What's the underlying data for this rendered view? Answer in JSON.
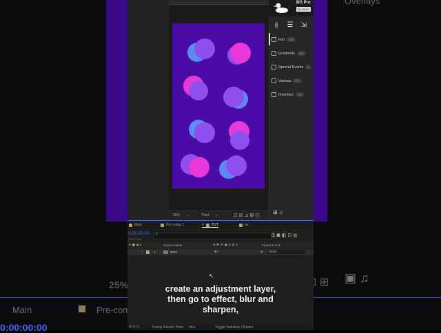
{
  "background": {
    "top_right_label": "Overlays",
    "zoom": "25%",
    "tab_main": "Main",
    "tab_precomp": "Pre-comp",
    "timecode": "0:00:00:00"
  },
  "viewer": {
    "zoom": "25%",
    "resolution": "Third"
  },
  "plugin": {
    "title": "BG Pro",
    "subtitle": "by Sono",
    "categories": [
      {
        "label": "Flat",
        "count": "155"
      },
      {
        "label": "Gradients",
        "count": "185"
      },
      {
        "label": "Special Events",
        "count": "4"
      },
      {
        "label": "Various",
        "count": "277"
      },
      {
        "label": "Overlays",
        "count": "233"
      }
    ]
  },
  "timeline": {
    "tabs": [
      "Main",
      "Pre-comp 1",
      "TUT",
      "ee"
    ],
    "timecode": "0;00;00;00",
    "fps": "(29.97 fps)",
    "search_placeholder": "",
    "col_source": "Source Name",
    "col_parent": "Parent & Link",
    "layer_index": "1",
    "layer_name": "BGG",
    "layer_parent": "None",
    "render_label": "Frame Render Time:",
    "render_value": "3ms",
    "toggle_label": "Toggle Switches / Modes"
  },
  "caption": {
    "line1": "create an adjustment layer,",
    "line2": "then go to effect, blur and",
    "line3": "sharpen,"
  },
  "colors": {
    "canvas": "#4a0ba6",
    "dot_blue": "#5a8cf0",
    "dot_pink": "#e838d8",
    "dot_violet": "#8f4fee",
    "accent": "#3e64ff"
  }
}
